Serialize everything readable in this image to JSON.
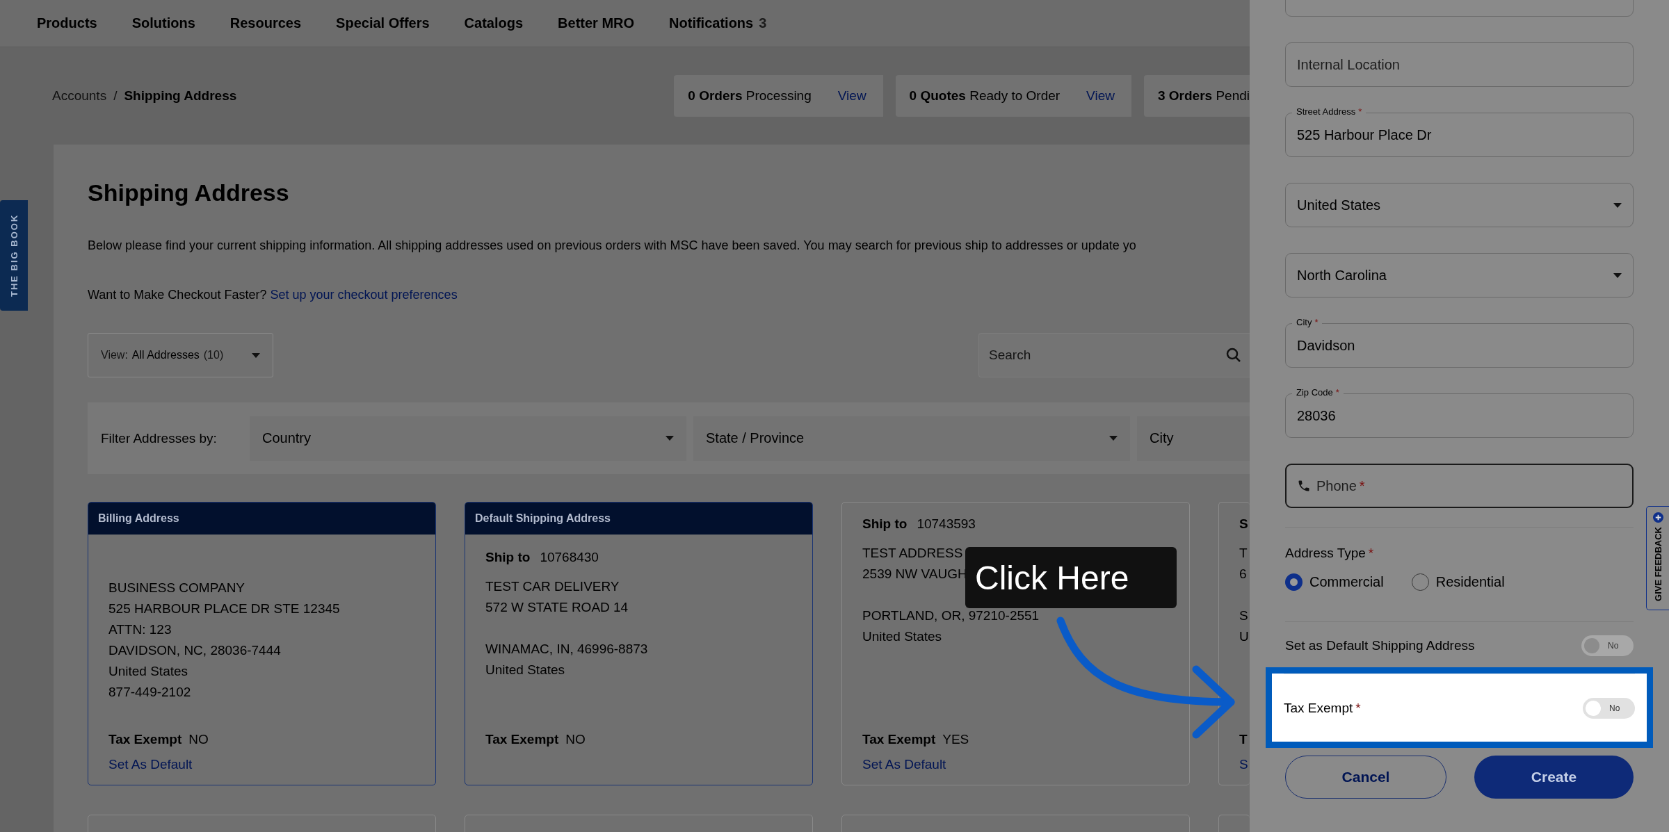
{
  "nav": {
    "items": [
      {
        "label": "Products"
      },
      {
        "label": "Solutions"
      },
      {
        "label": "Resources"
      },
      {
        "label": "Special Offers"
      },
      {
        "label": "Catalogs"
      },
      {
        "label": "Better MRO"
      },
      {
        "label": "Notifications",
        "count": "3"
      }
    ]
  },
  "breadcrumb": {
    "items": [
      "Accounts",
      "Shipping Address"
    ],
    "separator": "/"
  },
  "order_stats": [
    {
      "count": "0 Orders",
      "label": "Processing",
      "link": "View"
    },
    {
      "count": "0 Quotes",
      "label": "Ready to Order",
      "link": "View"
    },
    {
      "count": "3 Orders",
      "label": "Pendi"
    }
  ],
  "side_tab": "THE BIG BOOK",
  "page": {
    "title": "Shipping Address",
    "description": "Below please find your current shipping information. All shipping addresses used on previous orders with MSC have been saved. You may search for previous ship to addresses or update yo",
    "prompt": "Want to Make Checkout Faster?",
    "prompt_link": "Set up your checkout preferences"
  },
  "view_select": {
    "label": "View:",
    "value": "All Addresses",
    "count": "(10)"
  },
  "search": {
    "placeholder": "Search"
  },
  "filter": {
    "label": "Filter Addresses by:",
    "selects": [
      "Country",
      "State / Province",
      "City"
    ]
  },
  "cards": [
    {
      "header": "Billing Address",
      "blocks": [
        [
          "BUSINESS COMPANY",
          "525 HARBOUR PLACE DR STE 12345",
          "ATTN: 123",
          "DAVIDSON, NC, 28036-7444",
          "United States",
          "877-449-2102"
        ]
      ],
      "tax_label": "Tax Exempt",
      "tax_value": "NO",
      "link": "Set As Default"
    },
    {
      "header": "Default Shipping Address",
      "ship_label": "Ship to",
      "ship_number": "10768430",
      "blocks": [
        [
          "TEST CAR DELIVERY",
          "572 W STATE ROAD 14"
        ],
        [
          "WINAMAC, IN, 46996-8873",
          "United States"
        ]
      ],
      "tax_label": "Tax Exempt",
      "tax_value": "NO"
    },
    {
      "ship_label": "Ship to",
      "ship_number": "10743593",
      "blocks": [
        [
          "TEST ADDRESS",
          "2539 NW VAUGH"
        ],
        [
          "PORTLAND, OR, 97210-2551",
          "United States"
        ]
      ],
      "tax_label": "Tax Exempt",
      "tax_value": "YES",
      "link": "Set As Default"
    },
    {
      "ship_label": "S",
      "blocks": [
        [
          "T",
          "6"
        ],
        [
          "S",
          "U"
        ]
      ],
      "tax_label": "T",
      "link": "S"
    }
  ],
  "tooltip": {
    "text": "Click Here"
  },
  "panel": {
    "fields": [
      {
        "kind": "text"
      },
      {
        "kind": "text",
        "placeholder": "Internal Location"
      },
      {
        "kind": "text",
        "label": "Street Address",
        "mark": "*",
        "value": "525 Harbour Place Dr"
      },
      {
        "kind": "select",
        "value": "United States"
      },
      {
        "kind": "select",
        "value": "North Carolina"
      },
      {
        "kind": "text",
        "label": "City",
        "mark": "*",
        "value": "Davidson"
      },
      {
        "kind": "text",
        "label": "Zip Code",
        "mark": "*",
        "value": "28036"
      },
      {
        "kind": "phone",
        "placeholder": "Phone",
        "mark": "*",
        "focused": true
      }
    ],
    "address_type": {
      "label": "Address Type",
      "mark": "*",
      "options": [
        {
          "label": "Commercial",
          "selected": true
        },
        {
          "label": "Residential",
          "selected": false
        }
      ]
    },
    "toggles": [
      {
        "label": "Set as Default Shipping Address",
        "on": false,
        "state_text": "No",
        "highlighted": false
      },
      {
        "label": "Tax Exempt",
        "mark": "*",
        "on": false,
        "state_text": "No",
        "highlighted": true
      }
    ],
    "buttons": [
      {
        "label": "Cancel",
        "kind": "secondary"
      },
      {
        "label": "Create",
        "kind": "primary"
      }
    ]
  },
  "feedback_tab": "GIVE FEEDBACK"
}
